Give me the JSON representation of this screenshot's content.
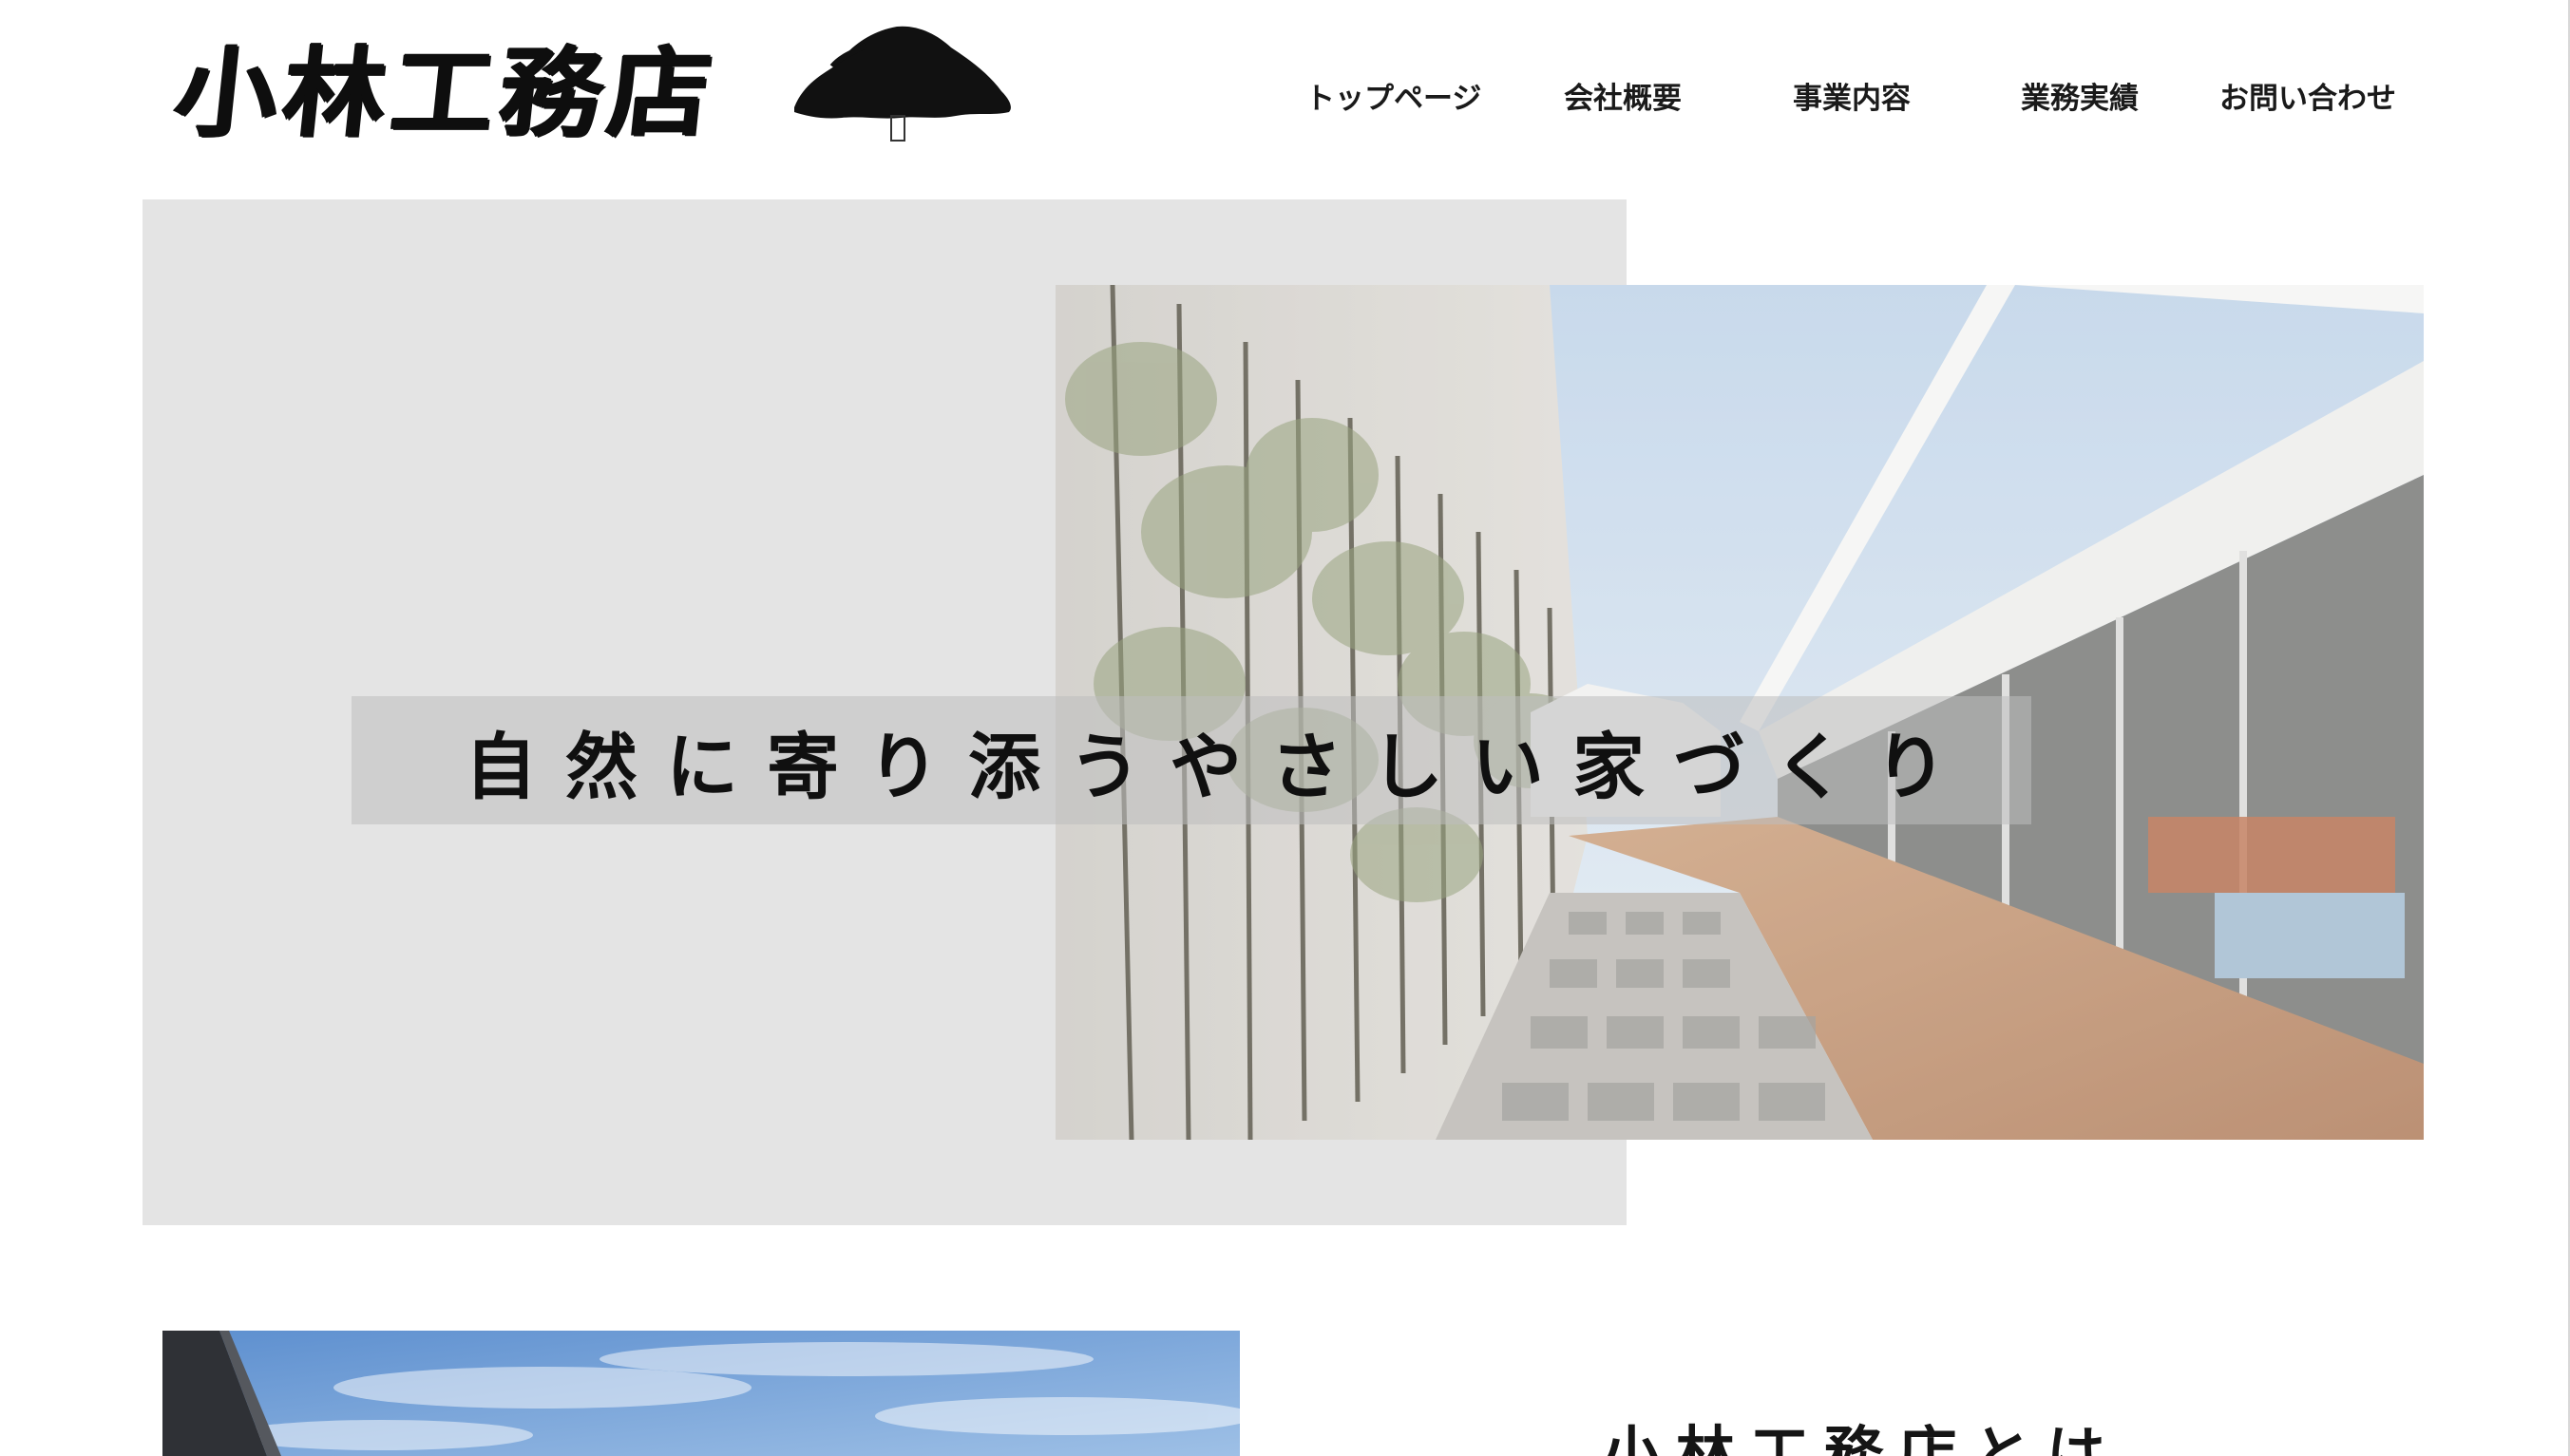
{
  "header": {
    "logo_text": "小林工務店",
    "logo_icon": "tree-icon",
    "nav": [
      {
        "label": "トップページ"
      },
      {
        "label": "会社概要"
      },
      {
        "label": "事業内容"
      },
      {
        "label": "業務実績"
      },
      {
        "label": "お問い合わせ"
      }
    ]
  },
  "hero": {
    "tagline": "自然に寄り添うやさしい家づくり",
    "image": "courtyard-house-photo"
  },
  "about": {
    "image": "house-exterior-sky-photo",
    "title": "小林工務店とは"
  },
  "colors": {
    "hero_panel": "#e4e4e4",
    "tagline_band": "#bebebe",
    "text": "#111111"
  }
}
